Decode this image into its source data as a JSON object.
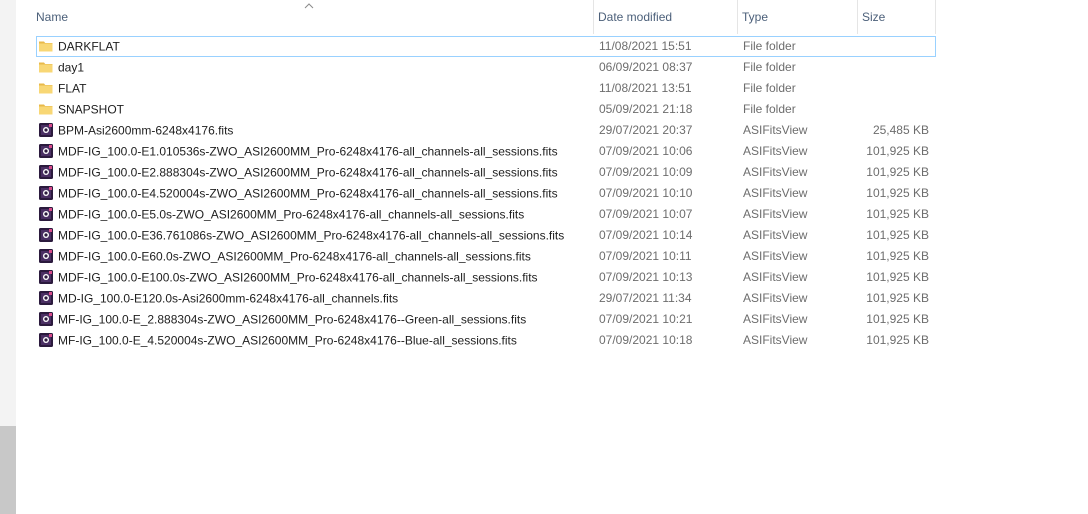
{
  "columns": {
    "name": "Name",
    "date_modified": "Date modified",
    "type": "Type",
    "size": "Size"
  },
  "colors": {
    "folder": "#f8d775",
    "fits_icon": "#2b1a3d",
    "selection": "#99d1ff"
  },
  "rows": [
    {
      "name": "DARKFLAT",
      "date": "11/08/2021 15:51",
      "type": "File folder",
      "size": "",
      "icon": "folder-icon"
    },
    {
      "name": "day1",
      "date": "06/09/2021 08:37",
      "type": "File folder",
      "size": "",
      "icon": "folder-icon"
    },
    {
      "name": "FLAT",
      "date": "11/08/2021 13:51",
      "type": "File folder",
      "size": "",
      "icon": "folder-icon"
    },
    {
      "name": "SNAPSHOT",
      "date": "05/09/2021 21:18",
      "type": "File folder",
      "size": "",
      "icon": "folder-icon"
    },
    {
      "name": "BPM-Asi2600mm-6248x4176.fits",
      "date": "29/07/2021 20:37",
      "type": "ASIFitsView",
      "size": "25,485 KB",
      "icon": "fits-file-icon"
    },
    {
      "name": "MDF-IG_100.0-E1.010536s-ZWO_ASI2600MM_Pro-6248x4176-all_channels-all_sessions.fits",
      "date": "07/09/2021 10:06",
      "type": "ASIFitsView",
      "size": "101,925 KB",
      "icon": "fits-file-icon"
    },
    {
      "name": "MDF-IG_100.0-E2.888304s-ZWO_ASI2600MM_Pro-6248x4176-all_channels-all_sessions.fits",
      "date": "07/09/2021 10:09",
      "type": "ASIFitsView",
      "size": "101,925 KB",
      "icon": "fits-file-icon"
    },
    {
      "name": "MDF-IG_100.0-E4.520004s-ZWO_ASI2600MM_Pro-6248x4176-all_channels-all_sessions.fits",
      "date": "07/09/2021 10:10",
      "type": "ASIFitsView",
      "size": "101,925 KB",
      "icon": "fits-file-icon"
    },
    {
      "name": "MDF-IG_100.0-E5.0s-ZWO_ASI2600MM_Pro-6248x4176-all_channels-all_sessions.fits",
      "date": "07/09/2021 10:07",
      "type": "ASIFitsView",
      "size": "101,925 KB",
      "icon": "fits-file-icon"
    },
    {
      "name": "MDF-IG_100.0-E36.761086s-ZWO_ASI2600MM_Pro-6248x4176-all_channels-all_sessions.fits",
      "date": "07/09/2021 10:14",
      "type": "ASIFitsView",
      "size": "101,925 KB",
      "icon": "fits-file-icon"
    },
    {
      "name": "MDF-IG_100.0-E60.0s-ZWO_ASI2600MM_Pro-6248x4176-all_channels-all_sessions.fits",
      "date": "07/09/2021 10:11",
      "type": "ASIFitsView",
      "size": "101,925 KB",
      "icon": "fits-file-icon"
    },
    {
      "name": "MDF-IG_100.0-E100.0s-ZWO_ASI2600MM_Pro-6248x4176-all_channels-all_sessions.fits",
      "date": "07/09/2021 10:13",
      "type": "ASIFitsView",
      "size": "101,925 KB",
      "icon": "fits-file-icon"
    },
    {
      "name": "MD-IG_100.0-E120.0s-Asi2600mm-6248x4176-all_channels.fits",
      "date": "29/07/2021 11:34",
      "type": "ASIFitsView",
      "size": "101,925 KB",
      "icon": "fits-file-icon"
    },
    {
      "name": "MF-IG_100.0-E_2.888304s-ZWO_ASI2600MM_Pro-6248x4176--Green-all_sessions.fits",
      "date": "07/09/2021 10:21",
      "type": "ASIFitsView",
      "size": "101,925 KB",
      "icon": "fits-file-icon"
    },
    {
      "name": "MF-IG_100.0-E_4.520004s-ZWO_ASI2600MM_Pro-6248x4176--Blue-all_sessions.fits",
      "date": "07/09/2021 10:18",
      "type": "ASIFitsView",
      "size": "101,925 KB",
      "icon": "fits-file-icon"
    }
  ]
}
